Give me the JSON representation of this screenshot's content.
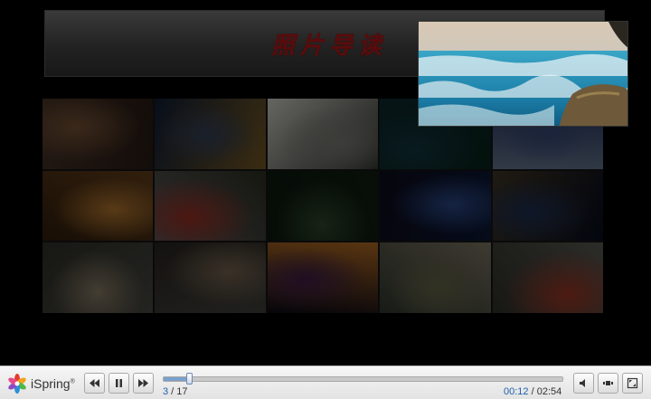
{
  "slide": {
    "title": "照片导读",
    "thumbnails": [
      {
        "name": "street-night-crowd",
        "colors": [
          "#3a2a20",
          "#6b4a30",
          "#241812"
        ]
      },
      {
        "name": "tower-night",
        "colors": [
          "#0e1a30",
          "#2e3a4e",
          "#6a5020"
        ]
      },
      {
        "name": "waterfall",
        "colors": [
          "#b9b9b0",
          "#6e6e68",
          "#2a2e2a"
        ]
      },
      {
        "name": "dark-water",
        "colors": [
          "#0a2428",
          "#103038",
          "#062018"
        ]
      },
      {
        "name": "stone-inscription",
        "colors": [
          "#1d2a50",
          "#30406a",
          "#5a6a80"
        ]
      },
      {
        "name": "lobby-interior",
        "colors": [
          "#5a3818",
          "#a06a2a",
          "#2a1a0a"
        ]
      },
      {
        "name": "boat-temple",
        "colors": [
          "#2a2a20",
          "#8a2a20",
          "#505050"
        ]
      },
      {
        "name": "lake-reflection",
        "colors": [
          "#0e1c10",
          "#2a4028",
          "#0a140a"
        ]
      },
      {
        "name": "skyscraper-night",
        "colors": [
          "#0a1530",
          "#26407a",
          "#0a0a18"
        ]
      },
      {
        "name": "city-night-skyline",
        "colors": [
          "#050a1a",
          "#1a2a4a",
          "#3a3020"
        ]
      },
      {
        "name": "shopping-street",
        "colors": [
          "#40403a",
          "#7a6e5a",
          "#2a2a24"
        ]
      },
      {
        "name": "plaza-sculpture",
        "colors": [
          "#3a3a36",
          "#6a5a48",
          "#25211c"
        ]
      },
      {
        "name": "neon-building",
        "colors": [
          "#0a0812",
          "#3a1a40",
          "#a06020"
        ]
      },
      {
        "name": "mountain-temple",
        "colors": [
          "#2a3028",
          "#5a5a40",
          "#706a5a"
        ]
      },
      {
        "name": "boat-temple-2",
        "colors": [
          "#2a2a24",
          "#8a3020",
          "#50504a"
        ]
      }
    ],
    "overlay_photo": "ocean-waves-rock"
  },
  "player": {
    "brand": "iSpring",
    "brand_mark": "®",
    "slide_current": "3",
    "slide_sep": " / ",
    "slide_total": "17",
    "time_current": "00:12",
    "time_sep": " / ",
    "time_total": "02:54",
    "progress_fraction": 0.065,
    "icons": {
      "prev": "rewind-icon",
      "pause": "pause-icon",
      "next": "fast-forward-icon",
      "volume": "volume-icon",
      "layout": "layout-icon",
      "fullscreen": "fullscreen-icon"
    }
  }
}
